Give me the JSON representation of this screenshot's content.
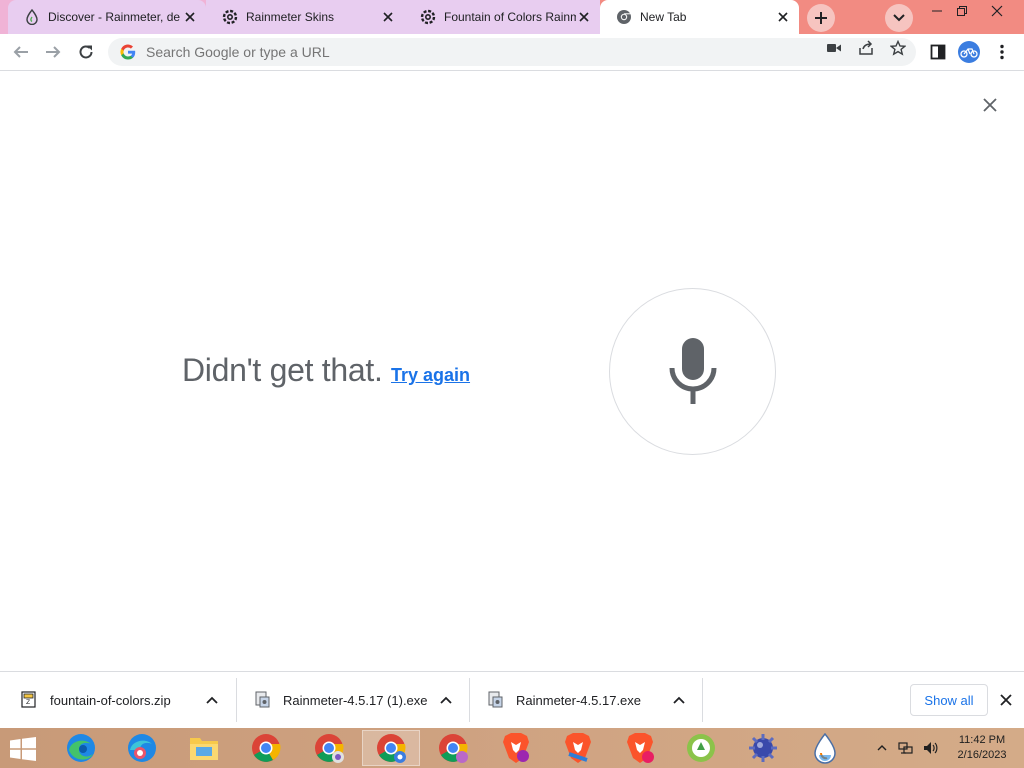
{
  "tabs": [
    {
      "title": "Discover - Rainmeter, de",
      "icon": "rainmeter-drop-icon",
      "active": false
    },
    {
      "title": "Rainmeter Skins",
      "icon": "gear-icon",
      "active": false
    },
    {
      "title": "Fountain of Colors Rainm",
      "icon": "gear-icon",
      "active": false
    },
    {
      "title": "New Tab",
      "icon": "chrome-icon",
      "active": true
    }
  ],
  "omnibox": {
    "placeholder": "Search Google or type a URL"
  },
  "voice_search": {
    "message": "Didn't get that.",
    "retry_link": "Try again"
  },
  "downloads": [
    {
      "name": "fountain-of-colors.zip",
      "icon": "zip-file-icon"
    },
    {
      "name": "Rainmeter-4.5.17 (1).exe",
      "icon": "installer-icon"
    },
    {
      "name": "Rainmeter-4.5.17.exe",
      "icon": "installer-icon"
    }
  ],
  "shelf": {
    "show_all_label": "Show all"
  },
  "taskbar": {
    "apps": [
      "edge-icon",
      "edge-dev-icon",
      "file-explorer-icon",
      "chrome-icon",
      "chrome-profile-icon",
      "chrome-profile-active-icon",
      "chrome-profile-icon",
      "brave-icon",
      "brave-nightly-icon",
      "brave-beta-icon",
      "green-app-icon",
      "virus-app-icon",
      "rainmeter-drop-icon"
    ],
    "time": "11:42 PM",
    "date": "2/16/2023"
  },
  "colors": {
    "tabstrip": "#f28b82",
    "accent": "#1a73e8",
    "mic": "#5f6368"
  }
}
